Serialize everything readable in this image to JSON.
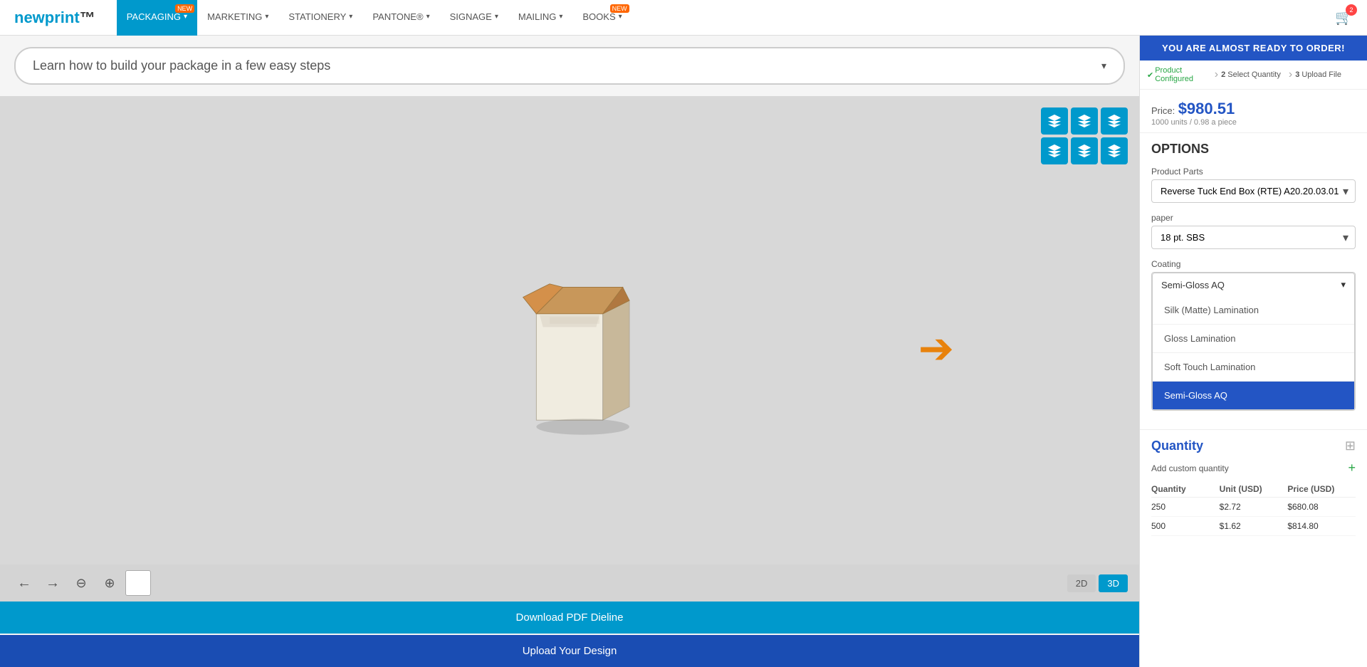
{
  "nav": {
    "logo_new": "new",
    "logo_print": "print",
    "items": [
      {
        "label": "PACKAGING",
        "active": true,
        "badge": "NEW",
        "chevron": true
      },
      {
        "label": "MARKETING",
        "active": false,
        "badge": null,
        "chevron": true
      },
      {
        "label": "STATIONERY",
        "active": false,
        "badge": null,
        "chevron": true
      },
      {
        "label": "PANTONE®",
        "active": false,
        "badge": null,
        "chevron": true
      },
      {
        "label": "SIGNAGE",
        "active": false,
        "badge": null,
        "chevron": true
      },
      {
        "label": "MAILING",
        "active": false,
        "badge": null,
        "chevron": true
      },
      {
        "label": "BOOKS",
        "active": false,
        "badge": "NEW",
        "chevron": true
      }
    ],
    "cart_count": "2"
  },
  "banner": {
    "text": "Learn how to build your package in a few easy steps",
    "chevron": "▾"
  },
  "order_bar": {
    "label": "YOU ARE ALMOST READY TO ORDER!"
  },
  "order_steps": [
    {
      "num": "",
      "label": "Product Configured",
      "check": true
    },
    {
      "num": "2",
      "label": "Select Quantity"
    },
    {
      "num": "3",
      "label": "Upload File"
    }
  ],
  "price": {
    "label": "Price:",
    "amount": "$980.51",
    "sub": "1000 units / 0.98 a piece"
  },
  "options": {
    "title": "OPTIONS",
    "product_parts_label": "Product Parts",
    "product_parts_value": "Reverse Tuck End Box (RTE) A20.20.03.01",
    "paper_label": "paper",
    "paper_value": "18 pt. SBS",
    "coating_label": "Coating",
    "coating_value": "Semi-Gloss AQ",
    "coating_dropdown_items": [
      {
        "label": "Silk (Matte) Lamination",
        "selected": false
      },
      {
        "label": "Gloss Lamination",
        "selected": false
      },
      {
        "label": "Soft Touch Lamination",
        "selected": false
      },
      {
        "label": "Semi-Gloss AQ",
        "selected": true
      }
    ]
  },
  "quantity": {
    "title": "Quantity",
    "add_label": "Add custom quantity",
    "columns": [
      "Quantity",
      "Unit (USD)",
      "Price (USD)"
    ],
    "rows": [
      {
        "qty": "250",
        "unit": "$2.72",
        "price": "$680.08"
      },
      {
        "qty": "500",
        "unit": "$1.62",
        "price": "$814.80"
      }
    ]
  },
  "viewer": {
    "download_btn": "Download PDF Dieline",
    "upload_btn": "Upload Your Design",
    "view_2d": "2D",
    "view_3d": "3D"
  }
}
